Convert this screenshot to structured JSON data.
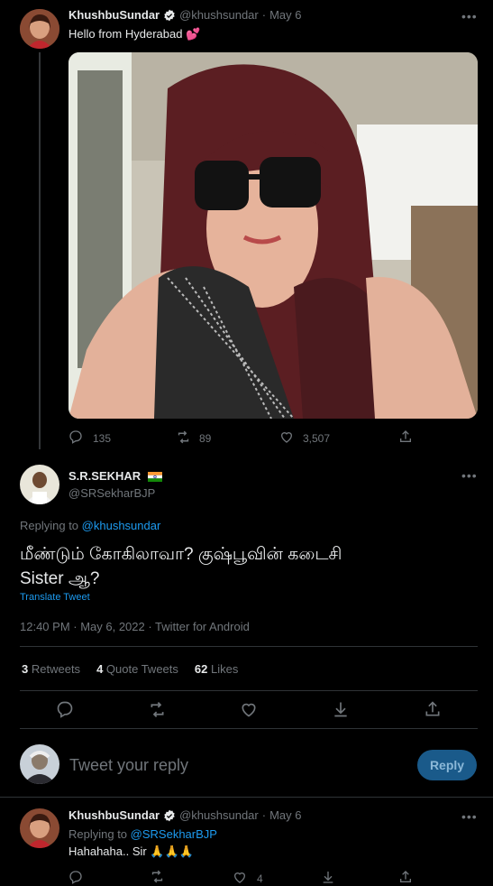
{
  "tweet1": {
    "name": "KhushbuSundar",
    "handle": "@khushsundar",
    "date": "May 6",
    "text": "Hello from Hyderabad",
    "emoji": "💕",
    "replies": "135",
    "retweets": "89",
    "likes": "3,507"
  },
  "focus": {
    "name": "S.R.SEKHAR",
    "handle": "@SRSekharBJP",
    "replying_label": "Replying to",
    "replying_to": "@khushsundar",
    "text_line1": "மீண்டும் கோகிலாவா? குஷ்பூவின் கடைசி",
    "text_line2": "Sister ஆ?",
    "translate": "Translate Tweet",
    "timestamp": "12:40 PM · May 6, 2022 · Twitter for Android",
    "retweets_count": "3",
    "retweets_label": "Retweets",
    "quotes_count": "4",
    "quotes_label": "Quote Tweets",
    "likes_count": "62",
    "likes_label": "Likes"
  },
  "compose": {
    "placeholder": "Tweet your reply",
    "button": "Reply"
  },
  "reply": {
    "name": "KhushbuSundar",
    "handle": "@khushsundar",
    "date": "May 6",
    "replying_label": "Replying to",
    "replying_to": "@SRSekharBJP",
    "text": "Hahahaha.. Sir",
    "emoji": "🙏🙏🙏",
    "likes": "4"
  },
  "colors": {
    "background": "#000000",
    "accent": "#1d9bf0",
    "muted": "#71767b",
    "verified": "#e7e9ea"
  }
}
